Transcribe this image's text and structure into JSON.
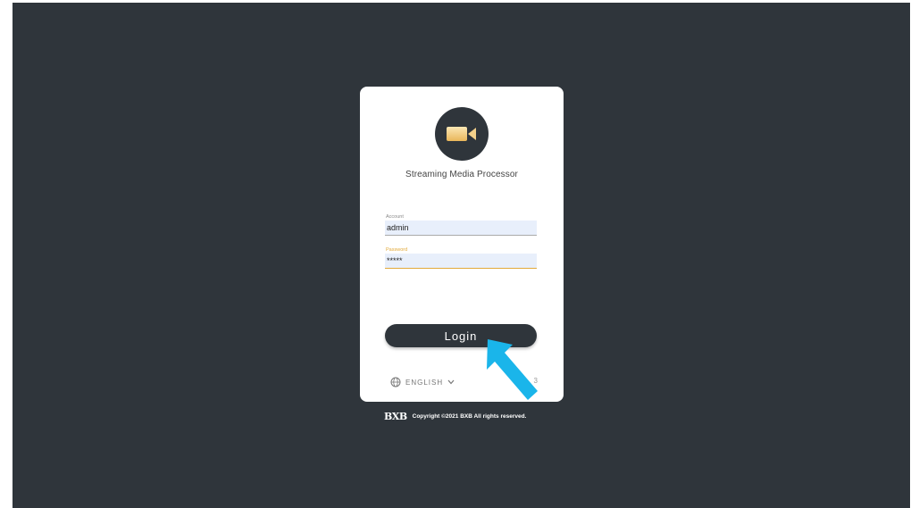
{
  "app": {
    "title": "Streaming Media Processor",
    "logo_icon": "video-camera-icon"
  },
  "form": {
    "account_label": "Account",
    "account_value": "admin",
    "password_label": "Password",
    "password_value": "*****",
    "login_label": "Login"
  },
  "language": {
    "selected": "ENGLISH",
    "icon": "globe-icon"
  },
  "version": "3",
  "footer": {
    "brand": "BXB",
    "copyright": "Copyright ©2021 BXB All rights reserved."
  },
  "overlay": {
    "arrow_icon": "pointer-arrow-icon",
    "arrow_color": "#1ab5ea"
  },
  "colors": {
    "background": "#2f353b",
    "accent": "#e2a93a",
    "field_bg": "#e8effb"
  }
}
